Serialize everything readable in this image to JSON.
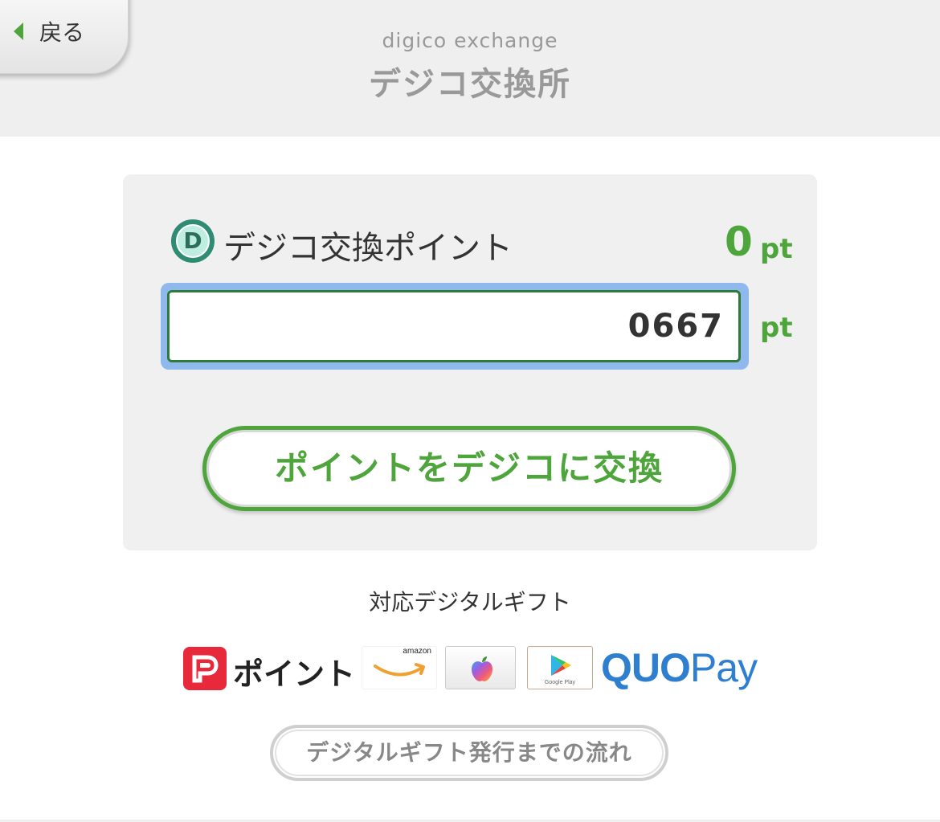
{
  "header": {
    "back_label": "戻る",
    "subtitle": "digico exchange",
    "title": "デジコ交換所"
  },
  "points": {
    "coin_letter": "D",
    "label": "デジコ交換ポイント",
    "balance": "0",
    "unit": "pt"
  },
  "exchange_input": {
    "value": "0667",
    "unit": "pt"
  },
  "exchange_button_label": "ポイントをデジコに交換",
  "gifts": {
    "title": "対応デジタルギフト",
    "paypay_label": "ポイント",
    "amazon_text": "amazon",
    "google_play_text": "Google Play",
    "quo_text": "QUO",
    "quo_pay_text": "Pay"
  },
  "flow_button_label": "デジタルギフト発行までの流れ",
  "colors": {
    "accent_green": "#4ea53c",
    "paypay_red": "#e8283b",
    "quo_blue": "#2f7fd0",
    "focus_blue": "#8fb8ec"
  }
}
